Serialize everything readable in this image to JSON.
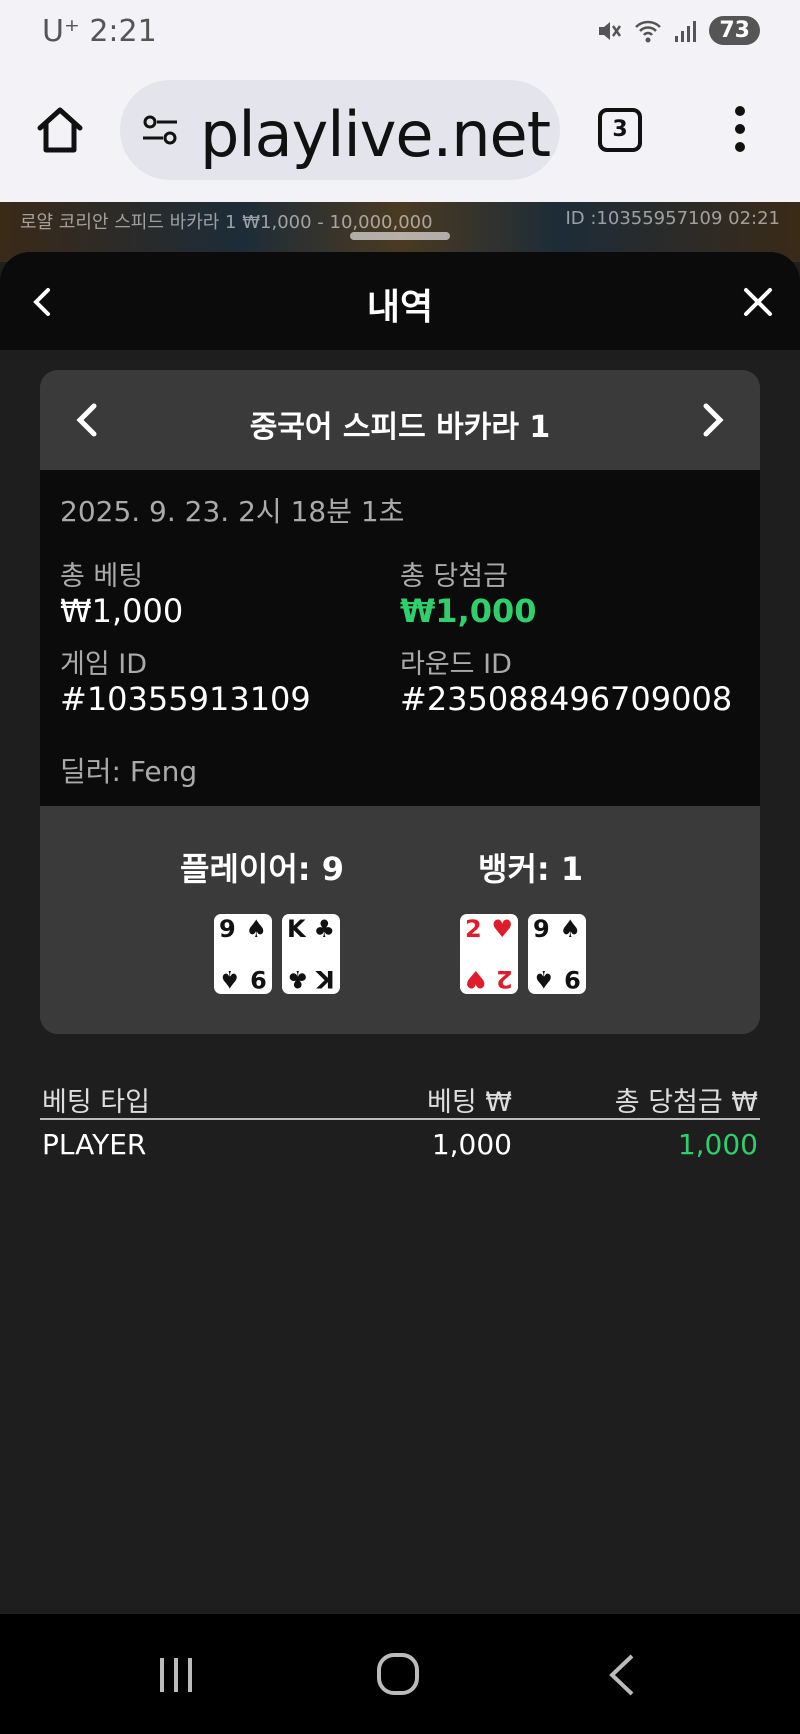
{
  "status": {
    "carrier_time": "U⁺ 2:21",
    "battery": "73"
  },
  "browser": {
    "url": "playlive.net",
    "tab_count": "3"
  },
  "game_strip": {
    "left_text": "로얄 코리안 스피드 바카라 1 ₩1,000 - 10,000,000",
    "right_text": "ID :10355957109 02:21"
  },
  "sheet": {
    "title": "내역"
  },
  "card": {
    "game_title": "중국어 스피드 바카라 1",
    "date": "2025. 9. 23. 2시 18분 1초",
    "total_bet_label": "총 베팅",
    "total_bet_value": "₩1,000",
    "total_win_label": "총 당첨금",
    "total_win_value": "₩1,000",
    "game_id_label": "게임 ID",
    "game_id_value": "#10355913109",
    "round_id_label": "라운드 ID",
    "round_id_value": "#235088496709008",
    "dealer": "딜러: Feng",
    "player_label": "플레이어: 9",
    "banker_label": "뱅커: 1",
    "player_cards": [
      {
        "rank": "9",
        "suit": "♠",
        "color": "black"
      },
      {
        "rank": "K",
        "suit": "♣",
        "color": "black"
      }
    ],
    "banker_cards": [
      {
        "rank": "2",
        "suit": "♥",
        "color": "red"
      },
      {
        "rank": "9",
        "suit": "♠",
        "color": "black"
      }
    ]
  },
  "bets": {
    "headers": [
      "베팅 타입",
      "베팅 ₩",
      "총 당첨금 ₩"
    ],
    "rows": [
      {
        "type": "PLAYER",
        "bet": "1,000",
        "win": "1,000"
      }
    ]
  },
  "colors": {
    "win_green": "#2fcf6c",
    "sheet_bg": "#1e1e1e",
    "panel_bg": "#3a3a3a"
  }
}
